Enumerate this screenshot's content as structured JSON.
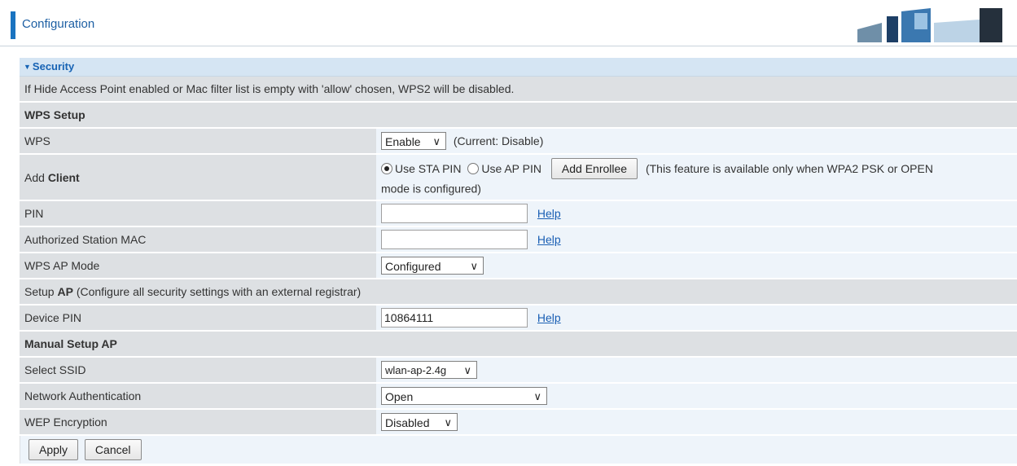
{
  "header": {
    "title": "Configuration"
  },
  "section": {
    "title": "Security"
  },
  "notice": "If Hide Access Point enabled or Mac filter list is empty with 'allow' chosen, WPS2 will be disabled.",
  "wps_setup": {
    "heading": "WPS Setup",
    "wps_label": "WPS",
    "wps_value": "Enable",
    "wps_current": "(Current: Disable)",
    "add_client_label_prefix": "Add ",
    "add_client_label_bold": "Client",
    "use_sta_pin": "Use STA PIN",
    "use_ap_pin": "Use AP PIN",
    "add_enrollee": "Add Enrollee",
    "enrollee_note_1": "(This feature is available only when WPA2 PSK or OPEN",
    "enrollee_note_2": "mode is configured)",
    "pin_label": "PIN",
    "pin_value": "",
    "auth_mac_label": "Authorized Station MAC",
    "auth_mac_value": "",
    "help": "Help",
    "ap_mode_label": "WPS AP Mode",
    "ap_mode_value": "Configured"
  },
  "setup_ap": {
    "prefix": "Setup ",
    "bold": "AP",
    "suffix": " (Configure all security settings with an external registrar)",
    "device_pin_label": "Device PIN",
    "device_pin_value": "10864111"
  },
  "manual": {
    "heading": "Manual Setup AP",
    "ssid_label": "Select SSID",
    "ssid_value": "wlan-ap-2.4g",
    "auth_label": "Network Authentication",
    "auth_value": "Open",
    "wep_label": "WEP Encryption",
    "wep_value": "Disabled"
  },
  "buttons": {
    "apply": "Apply",
    "cancel": "Cancel"
  },
  "icons": {
    "dropdown": "chevron-down-icon",
    "collapse": "triangle-down-icon"
  },
  "colors": {
    "accent": "#1a73c0",
    "label_bg": "#dde0e3",
    "value_bg": "#eef4fa",
    "section_bg": "#d5e5f3"
  }
}
